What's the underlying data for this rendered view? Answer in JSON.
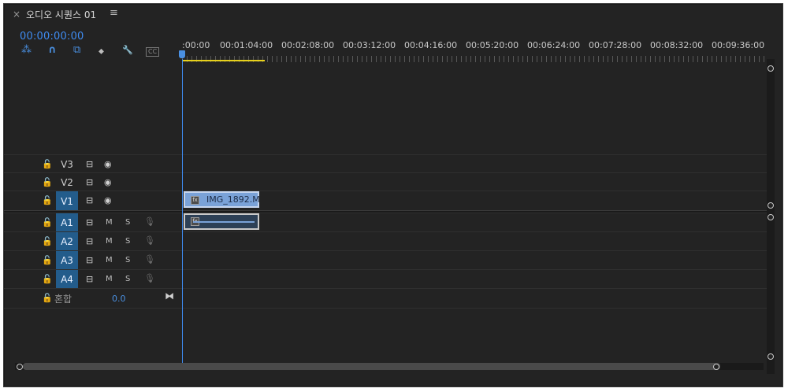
{
  "panel": {
    "close_glyph": "×",
    "title": "오디오 시퀀스 01",
    "menu_glyph": "≡"
  },
  "timecode": "00:00:00:00",
  "toolbar": {
    "icons": [
      "insert-overwrite-icon",
      "snap-magnet-icon",
      "linked-selection-icon",
      "add-marker-icon",
      "settings-wrench-icon",
      "captions-icon"
    ],
    "glyphs": [
      "⁂",
      "∩",
      "⧉",
      "⬥",
      "🔧",
      "CC"
    ]
  },
  "ruler": {
    "labels": [
      ":00:00",
      "00:01:04:00",
      "00:02:08:00",
      "00:03:12:00",
      "00:04:16:00",
      "00:05:20:00",
      "00:06:24:00",
      "00:07:28:00",
      "00:08:32:00",
      "00:09:36:00"
    ]
  },
  "video_tracks": [
    {
      "name": "V3",
      "active": false
    },
    {
      "name": "V2",
      "active": false
    },
    {
      "name": "V1",
      "active": true
    }
  ],
  "audio_tracks": [
    {
      "name": "A1",
      "active": true,
      "m": "M",
      "s": "S"
    },
    {
      "name": "A2",
      "active": true,
      "m": "M",
      "s": "S"
    },
    {
      "name": "A3",
      "active": true,
      "m": "M",
      "s": "S"
    },
    {
      "name": "A4",
      "active": true,
      "m": "M",
      "s": "S"
    }
  ],
  "mix": {
    "label": "혼합",
    "value": "0.0"
  },
  "clips": {
    "video_label": "IMG_1892.M"
  },
  "colors": {
    "accent": "#3f8cf2",
    "workbar": "#e7d11c",
    "track_active": "#235c8b"
  }
}
